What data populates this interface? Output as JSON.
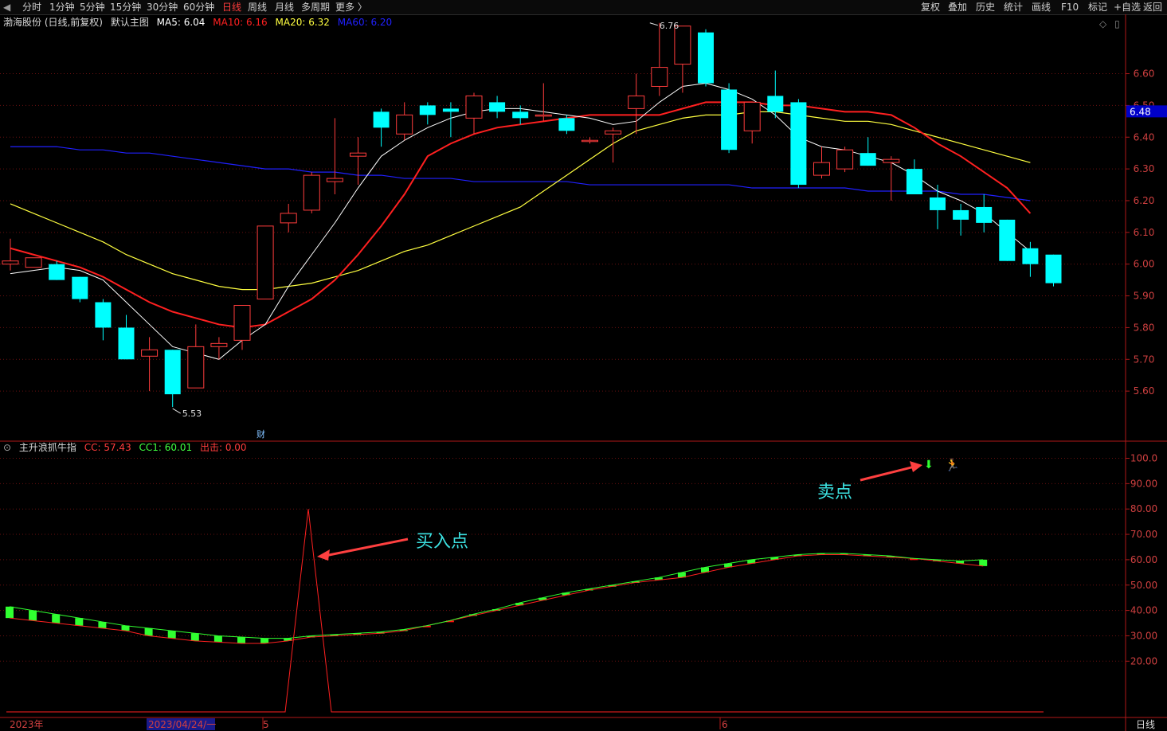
{
  "toolbar": {
    "left_items": [
      "分时",
      "1分钟",
      "5分钟",
      "15分钟",
      "30分钟",
      "60分钟",
      "日线",
      "周线",
      "月线",
      "多周期",
      "更多 〉"
    ],
    "active_item": "日线",
    "right_items": [
      "复权",
      "叠加",
      "历史",
      "统计",
      "画线",
      "F10",
      "标记",
      "+自选",
      "返回"
    ]
  },
  "main_legend": {
    "stock": "渤海股份 (日线,前复权)",
    "template": "默认主图",
    "ma5": "MA5: 6.04",
    "ma10": "MA10: 6.16",
    "ma20": "MA20: 6.32",
    "ma60": "MA60: 6.20"
  },
  "indicator_legend": {
    "name": "主升浪抓牛指",
    "cc": "CC: 57.43",
    "cc1": "CC1: 60.01",
    "out": "出击: 0.00"
  },
  "price_axis": {
    "ticks": [
      "6.60",
      "6.50",
      "6.40",
      "6.30",
      "6.20",
      "6.10",
      "6.00",
      "5.90",
      "5.80",
      "5.70",
      "5.60"
    ],
    "current": "6.48"
  },
  "indicator_axis": {
    "ticks": [
      "100.0",
      "90.00",
      "80.00",
      "70.00",
      "60.00",
      "50.00",
      "40.00",
      "30.00",
      "20.00"
    ]
  },
  "time_axis": {
    "year": "2023年",
    "cursor": "2023/04/24/一",
    "may": "5",
    "june": "6",
    "period": "日线"
  },
  "markers": {
    "high": "6.76",
    "low": "5.53",
    "finance": "财"
  },
  "annotations": {
    "buy": "买入点",
    "sell": "卖点"
  },
  "colors": {
    "background": "#000000",
    "up": "#ff3c3c",
    "down": "#00ffff",
    "ma5": "#ffffff",
    "ma10": "#ff2020",
    "ma20": "#ffff40",
    "ma60": "#2020ff",
    "annotation": "#3ce0e0",
    "current_price_bg": "#0000c8"
  },
  "chart_data": [
    {
      "type": "candlestick",
      "title": "渤海股份 (日线,前复权)",
      "candles": [
        {
          "o": 6.0,
          "h": 6.08,
          "l": 5.98,
          "c": 6.01
        },
        {
          "o": 5.99,
          "h": 6.01,
          "l": 5.99,
          "c": 6.02
        },
        {
          "o": 6.0,
          "h": 6.01,
          "l": 5.95,
          "c": 5.95
        },
        {
          "o": 5.96,
          "h": 5.96,
          "l": 5.88,
          "c": 5.89
        },
        {
          "o": 5.88,
          "h": 5.89,
          "l": 5.76,
          "c": 5.8
        },
        {
          "o": 5.8,
          "h": 5.84,
          "l": 5.7,
          "c": 5.7
        },
        {
          "o": 5.71,
          "h": 5.77,
          "l": 5.6,
          "c": 5.73
        },
        {
          "o": 5.73,
          "h": 5.73,
          "l": 5.55,
          "c": 5.59
        },
        {
          "o": 5.61,
          "h": 5.81,
          "l": 5.61,
          "c": 5.74
        },
        {
          "o": 5.74,
          "h": 5.77,
          "l": 5.7,
          "c": 5.75
        },
        {
          "o": 5.76,
          "h": 5.87,
          "l": 5.73,
          "c": 5.87
        },
        {
          "o": 5.89,
          "h": 6.06,
          "l": 5.89,
          "c": 6.12
        },
        {
          "o": 6.13,
          "h": 6.19,
          "l": 6.1,
          "c": 6.16
        },
        {
          "o": 6.17,
          "h": 6.29,
          "l": 6.16,
          "c": 6.28
        },
        {
          "o": 6.26,
          "h": 6.46,
          "l": 6.22,
          "c": 6.27
        },
        {
          "o": 6.34,
          "h": 6.4,
          "l": 6.25,
          "c": 6.35
        },
        {
          "o": 6.48,
          "h": 6.49,
          "l": 6.37,
          "c": 6.43
        },
        {
          "o": 6.41,
          "h": 6.51,
          "l": 6.39,
          "c": 6.47
        },
        {
          "o": 6.5,
          "h": 6.51,
          "l": 6.44,
          "c": 6.47
        },
        {
          "o": 6.49,
          "h": 6.51,
          "l": 6.4,
          "c": 6.48
        },
        {
          "o": 6.46,
          "h": 6.54,
          "l": 6.41,
          "c": 6.53
        },
        {
          "o": 6.51,
          "h": 6.53,
          "l": 6.46,
          "c": 6.48
        },
        {
          "o": 6.48,
          "h": 6.5,
          "l": 6.44,
          "c": 6.46
        },
        {
          "o": 6.47,
          "h": 6.57,
          "l": 6.45,
          "c": 6.47
        },
        {
          "o": 6.46,
          "h": 6.47,
          "l": 6.41,
          "c": 6.42
        },
        {
          "o": 6.39,
          "h": 6.4,
          "l": 6.38,
          "c": 6.39
        },
        {
          "o": 6.41,
          "h": 6.43,
          "l": 6.32,
          "c": 6.42
        },
        {
          "o": 6.49,
          "h": 6.6,
          "l": 6.41,
          "c": 6.53
        },
        {
          "o": 6.56,
          "h": 6.76,
          "l": 6.53,
          "c": 6.62
        },
        {
          "o": 6.63,
          "h": 6.75,
          "l": 6.54,
          "c": 6.75
        },
        {
          "o": 6.73,
          "h": 6.74,
          "l": 6.56,
          "c": 6.57
        },
        {
          "o": 6.55,
          "h": 6.57,
          "l": 6.35,
          "c": 6.36
        },
        {
          "o": 6.42,
          "h": 6.51,
          "l": 6.38,
          "c": 6.51
        },
        {
          "o": 6.53,
          "h": 6.61,
          "l": 6.46,
          "c": 6.48
        },
        {
          "o": 6.51,
          "h": 6.52,
          "l": 6.24,
          "c": 6.25
        },
        {
          "o": 6.28,
          "h": 6.37,
          "l": 6.27,
          "c": 6.32
        },
        {
          "o": 6.3,
          "h": 6.37,
          "l": 6.29,
          "c": 6.36
        },
        {
          "o": 6.35,
          "h": 6.4,
          "l": 6.31,
          "c": 6.31
        },
        {
          "o": 6.32,
          "h": 6.34,
          "l": 6.2,
          "c": 6.33
        },
        {
          "o": 6.3,
          "h": 6.33,
          "l": 6.22,
          "c": 6.22
        },
        {
          "o": 6.21,
          "h": 6.25,
          "l": 6.11,
          "c": 6.17
        },
        {
          "o": 6.17,
          "h": 6.19,
          "l": 6.09,
          "c": 6.14
        },
        {
          "o": 6.18,
          "h": 6.22,
          "l": 6.1,
          "c": 6.13
        },
        {
          "o": 6.14,
          "h": 6.14,
          "l": 6.01,
          "c": 6.01
        },
        {
          "o": 6.05,
          "h": 6.07,
          "l": 5.96,
          "c": 6.0
        },
        {
          "o": 6.03,
          "h": 6.03,
          "l": 5.93,
          "c": 5.94
        }
      ],
      "ma5": [
        5.97,
        5.98,
        5.99,
        5.98,
        5.95,
        5.88,
        5.81,
        5.74,
        5.72,
        5.7,
        5.76,
        5.81,
        5.93,
        6.03,
        6.13,
        6.24,
        6.34,
        6.39,
        6.43,
        6.46,
        6.48,
        6.49,
        6.49,
        6.48,
        6.47,
        6.46,
        6.44,
        6.45,
        6.51,
        6.56,
        6.57,
        6.55,
        6.52,
        6.47,
        6.4,
        6.37,
        6.36,
        6.34,
        6.32,
        6.28,
        6.23,
        6.2,
        6.16,
        6.1,
        6.04
      ],
      "ma10": [
        6.05,
        6.03,
        6.01,
        5.99,
        5.96,
        5.92,
        5.88,
        5.85,
        5.83,
        5.81,
        5.8,
        5.81,
        5.85,
        5.89,
        5.95,
        6.03,
        6.12,
        6.22,
        6.34,
        6.38,
        6.41,
        6.43,
        6.44,
        6.45,
        6.46,
        6.47,
        6.47,
        6.47,
        6.47,
        6.49,
        6.51,
        6.51,
        6.51,
        6.5,
        6.5,
        6.49,
        6.48,
        6.48,
        6.47,
        6.43,
        6.38,
        6.34,
        6.29,
        6.24,
        6.16
      ],
      "ma20": [
        6.19,
        6.16,
        6.13,
        6.1,
        6.07,
        6.03,
        6.0,
        5.97,
        5.95,
        5.93,
        5.92,
        5.92,
        5.93,
        5.94,
        5.96,
        5.98,
        6.01,
        6.04,
        6.06,
        6.09,
        6.12,
        6.15,
        6.18,
        6.23,
        6.28,
        6.33,
        6.38,
        6.42,
        6.44,
        6.46,
        6.47,
        6.47,
        6.48,
        6.48,
        6.47,
        6.46,
        6.45,
        6.45,
        6.44,
        6.42,
        6.4,
        6.38,
        6.36,
        6.34,
        6.32
      ],
      "ma60": [
        6.37,
        6.37,
        6.37,
        6.36,
        6.36,
        6.35,
        6.35,
        6.34,
        6.33,
        6.32,
        6.31,
        6.3,
        6.3,
        6.29,
        6.29,
        6.28,
        6.28,
        6.27,
        6.27,
        6.27,
        6.26,
        6.26,
        6.26,
        6.26,
        6.26,
        6.25,
        6.25,
        6.25,
        6.25,
        6.25,
        6.25,
        6.25,
        6.24,
        6.24,
        6.24,
        6.24,
        6.24,
        6.23,
        6.23,
        6.23,
        6.23,
        6.22,
        6.22,
        6.21,
        6.2
      ],
      "ylim": [
        5.54,
        6.72
      ],
      "current_price": 6.48
    },
    {
      "type": "bar",
      "title": "主升浪抓牛指",
      "series": [
        {
          "name": "CC",
          "values": [
            37,
            36,
            35,
            34,
            33,
            32,
            30,
            29,
            28,
            27.5,
            27,
            27,
            28,
            29.5,
            30,
            30.5,
            31,
            32,
            34,
            36,
            38,
            40,
            42,
            44,
            46,
            48,
            49.5,
            51,
            52,
            53,
            55,
            57,
            58.5,
            60,
            61.5,
            62,
            62,
            61.5,
            61,
            60.5,
            59.5,
            58.5,
            57.5
          ]
        },
        {
          "name": "CC1",
          "values": [
            41.5,
            40,
            38.5,
            37,
            35.5,
            34,
            33,
            32,
            31,
            30,
            29.5,
            29,
            29,
            30,
            30.5,
            31,
            31.5,
            32.5,
            34,
            36,
            38.5,
            40.5,
            43,
            45,
            47,
            48.5,
            50,
            51.5,
            53,
            55,
            57,
            58.5,
            60,
            61,
            62,
            62.5,
            62.5,
            62,
            61.5,
            60.5,
            60,
            59.5,
            60.01
          ]
        },
        {
          "name": "出击",
          "x": [
            12,
            13,
            14
          ],
          "values": [
            0,
            80,
            0
          ]
        }
      ],
      "ylim": [
        0,
        100
      ]
    }
  ]
}
